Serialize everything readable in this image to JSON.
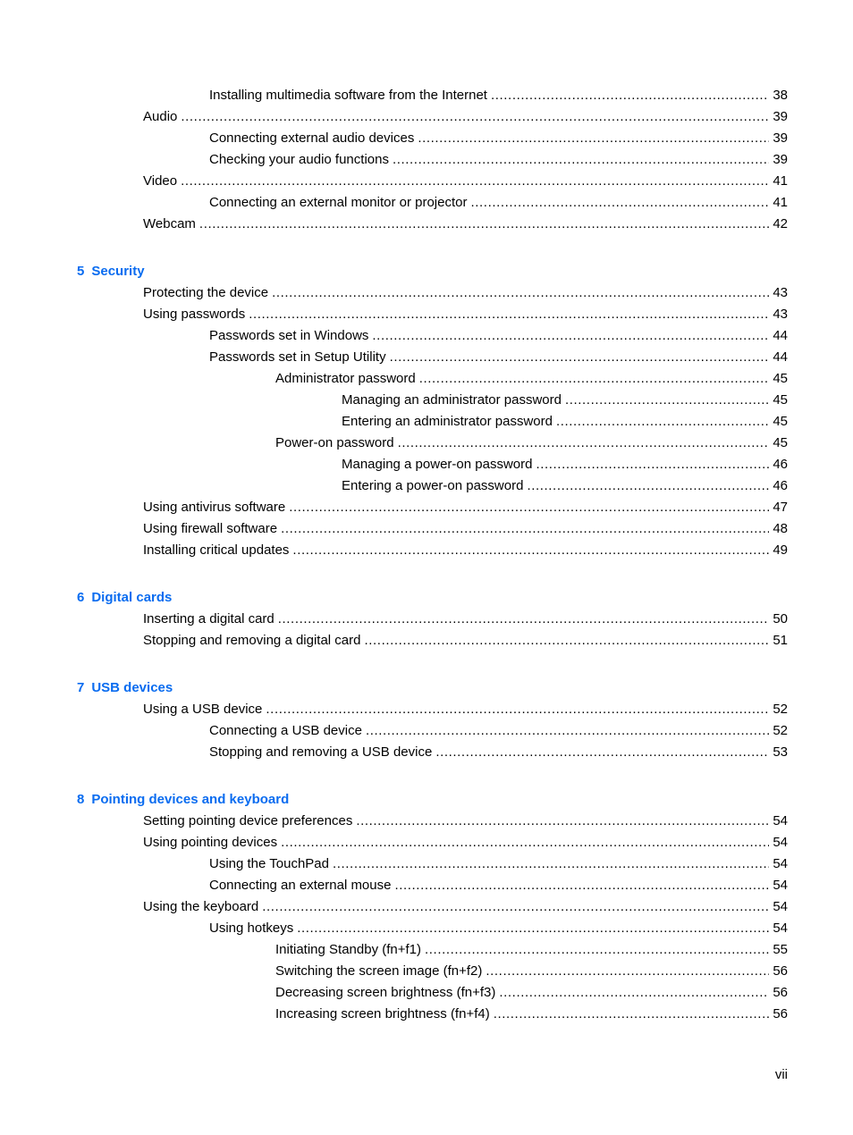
{
  "accent_color": "#0a6cf0",
  "entries_top": [
    {
      "level": 2,
      "title": "Installing multimedia software from the Internet",
      "page": "38"
    },
    {
      "level": 1,
      "title": "Audio",
      "page": "39"
    },
    {
      "level": 2,
      "title": "Connecting external audio devices",
      "page": "39"
    },
    {
      "level": 2,
      "title": "Checking your audio functions",
      "page": "39"
    },
    {
      "level": 1,
      "title": "Video",
      "page": "41"
    },
    {
      "level": 2,
      "title": "Connecting an external monitor or projector",
      "page": "41"
    },
    {
      "level": 1,
      "title": "Webcam",
      "page": "42"
    }
  ],
  "chapters": [
    {
      "number": "5",
      "title": "Security",
      "entries": [
        {
          "level": 1,
          "title": "Protecting the device",
          "page": "43"
        },
        {
          "level": 1,
          "title": "Using passwords",
          "page": "43"
        },
        {
          "level": 2,
          "title": "Passwords set in Windows",
          "page": "44"
        },
        {
          "level": 2,
          "title": "Passwords set in Setup Utility",
          "page": "44"
        },
        {
          "level": 3,
          "title": "Administrator password",
          "page": "45"
        },
        {
          "level": 4,
          "title": "Managing an administrator password",
          "page": "45"
        },
        {
          "level": 4,
          "title": "Entering an administrator password",
          "page": "45"
        },
        {
          "level": 3,
          "title": "Power-on password",
          "page": "45"
        },
        {
          "level": 4,
          "title": "Managing a power-on password",
          "page": "46"
        },
        {
          "level": 4,
          "title": "Entering a power-on password",
          "page": "46"
        },
        {
          "level": 1,
          "title": "Using antivirus software",
          "page": "47"
        },
        {
          "level": 1,
          "title": "Using firewall software",
          "page": "48"
        },
        {
          "level": 1,
          "title": "Installing critical updates",
          "page": "49"
        }
      ]
    },
    {
      "number": "6",
      "title": "Digital cards",
      "entries": [
        {
          "level": 1,
          "title": "Inserting a digital card",
          "page": "50"
        },
        {
          "level": 1,
          "title": "Stopping and removing a digital card",
          "page": "51"
        }
      ]
    },
    {
      "number": "7",
      "title": "USB devices",
      "entries": [
        {
          "level": 1,
          "title": "Using a USB device",
          "page": "52"
        },
        {
          "level": 2,
          "title": "Connecting a USB device",
          "page": "52"
        },
        {
          "level": 2,
          "title": "Stopping and removing a USB device",
          "page": "53"
        }
      ]
    },
    {
      "number": "8",
      "title": "Pointing devices and keyboard",
      "entries": [
        {
          "level": 1,
          "title": "Setting pointing device preferences",
          "page": "54"
        },
        {
          "level": 1,
          "title": "Using pointing devices",
          "page": "54"
        },
        {
          "level": 2,
          "title": "Using the TouchPad",
          "page": "54"
        },
        {
          "level": 2,
          "title": "Connecting an external mouse",
          "page": "54"
        },
        {
          "level": 1,
          "title": "Using the keyboard",
          "page": "54"
        },
        {
          "level": 2,
          "title": "Using hotkeys",
          "page": "54"
        },
        {
          "level": 3,
          "title": "Initiating Standby (fn+f1)",
          "page": "55"
        },
        {
          "level": 3,
          "title": "Switching the screen image (fn+f2)",
          "page": "56"
        },
        {
          "level": 3,
          "title": "Decreasing screen brightness (fn+f3)",
          "page": "56"
        },
        {
          "level": 3,
          "title": "Increasing screen brightness (fn+f4)",
          "page": "56"
        }
      ]
    }
  ],
  "folio": "vii"
}
